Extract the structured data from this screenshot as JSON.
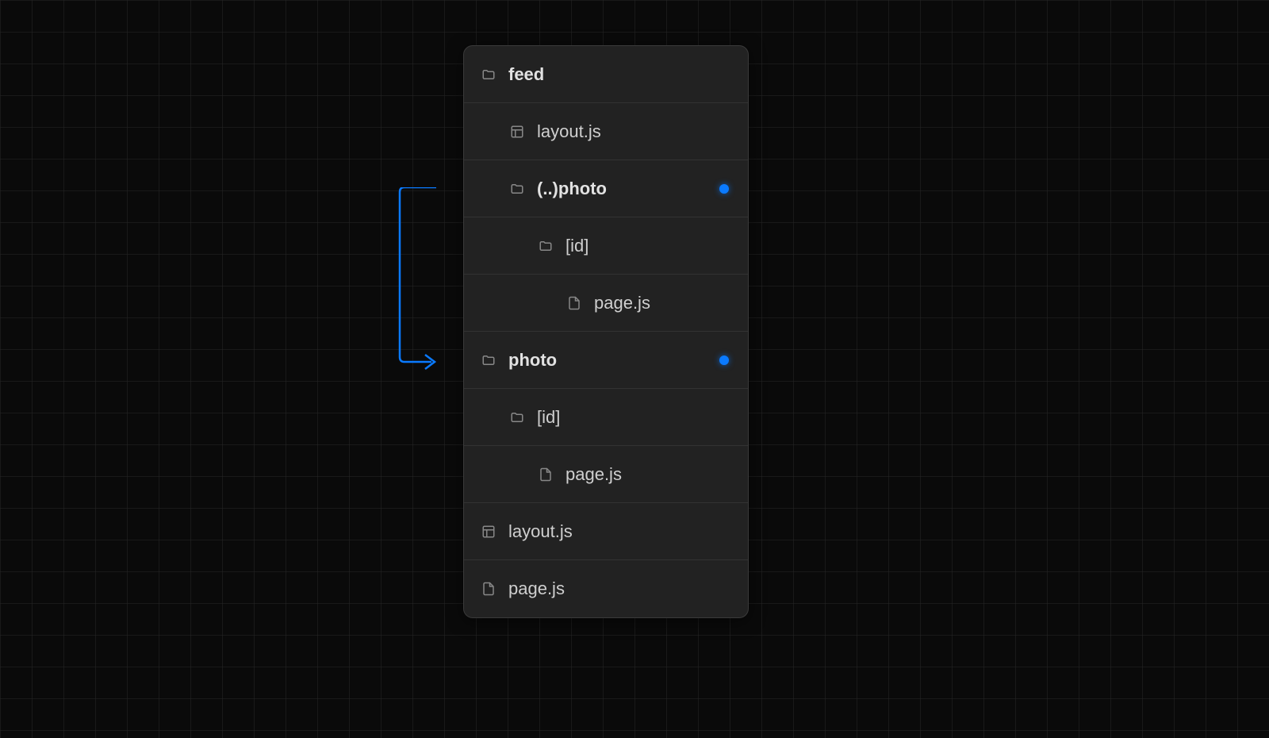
{
  "tree": {
    "items": [
      {
        "label": "feed",
        "icon": "folder",
        "indent": 0,
        "bold": true,
        "dot": false
      },
      {
        "label": "layout.js",
        "icon": "layout",
        "indent": 1,
        "bold": false,
        "dot": false
      },
      {
        "label": "(..)photo",
        "icon": "folder",
        "indent": 1,
        "bold": true,
        "dot": true
      },
      {
        "label": "[id]",
        "icon": "folder",
        "indent": 2,
        "bold": false,
        "dot": false
      },
      {
        "label": "page.js",
        "icon": "file",
        "indent": 3,
        "bold": false,
        "dot": false
      },
      {
        "label": "photo",
        "icon": "folder",
        "indent": 0,
        "bold": true,
        "dot": true
      },
      {
        "label": "[id]",
        "icon": "folder",
        "indent": 1,
        "bold": false,
        "dot": false
      },
      {
        "label": "page.js",
        "icon": "file",
        "indent": 2,
        "bold": false,
        "dot": false
      },
      {
        "label": "layout.js",
        "icon": "layout",
        "indent": 0,
        "bold": false,
        "dot": false
      },
      {
        "label": "page.js",
        "icon": "file",
        "indent": 0,
        "bold": false,
        "dot": false
      }
    ]
  },
  "colors": {
    "accent": "#0a7aff",
    "panel_bg": "#222222",
    "border": "#3a3a3a"
  }
}
